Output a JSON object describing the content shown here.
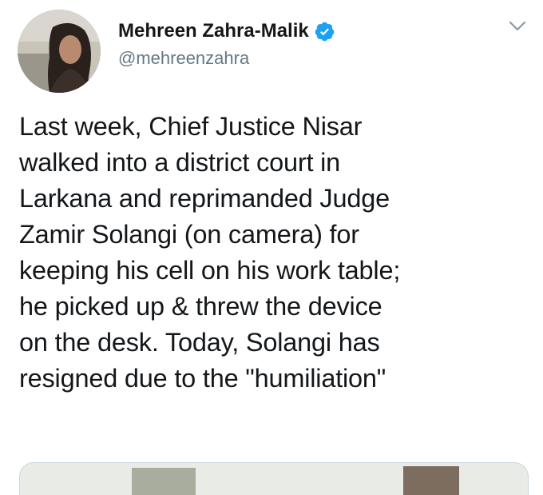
{
  "user": {
    "display_name": "Mehreen Zahra-Malik",
    "handle": "@mehreenzahra",
    "verified": true,
    "avatar_icon": "profile-photo"
  },
  "icons": {
    "verified": "verified-badge-icon",
    "more": "chevron-down-icon"
  },
  "colors": {
    "verified_blue": "#1da1f2",
    "text": "#14171a",
    "secondary": "#657786",
    "border": "#ccd6dd"
  },
  "tweet": {
    "lines": [
      "Last week, Chief Justice Nisar",
      "walked into a district court in",
      "Larkana and reprimanded Judge",
      "Zamir Solangi (on camera) for",
      "keeping his cell on his work table;",
      "he picked up & threw the device",
      "on the desk. Today, Solangi has",
      "resigned due to the \"humiliation\""
    ]
  }
}
